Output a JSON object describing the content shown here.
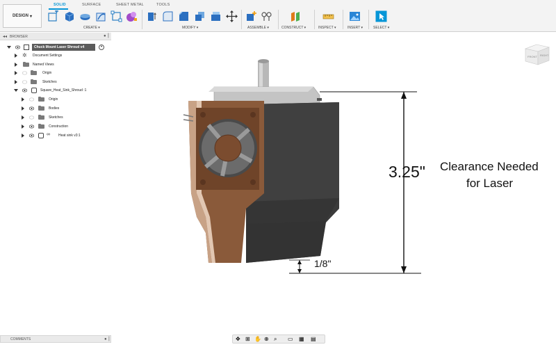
{
  "toolbar": {
    "workspace_label": "DESIGN",
    "tabs": [
      {
        "label": "SOLID"
      },
      {
        "label": "SURFACE"
      },
      {
        "label": "SHEET METAL"
      },
      {
        "label": "TOOLS"
      }
    ],
    "groups": [
      "CREATE",
      "MODIFY",
      "ASSEMBLE",
      "CONSTRUCT",
      "INSPECT",
      "INSERT",
      "SELECT"
    ],
    "accent": "#0696d7"
  },
  "browser": {
    "title": "BROWSER",
    "items": [
      {
        "label": "Chuck Mount Laser Shroud v4"
      },
      {
        "label": "Document Settings"
      },
      {
        "label": "Named Views"
      },
      {
        "label": "Origin"
      },
      {
        "label": "Sketches"
      },
      {
        "label": "Square_Heat_Sink_Shroud :1"
      },
      {
        "label": "Origin"
      },
      {
        "label": "Bodies"
      },
      {
        "label": "Sketches"
      },
      {
        "label": "Construction"
      },
      {
        "label": "Heat sink v3:1"
      }
    ]
  },
  "comments": {
    "title": "COMMENTS"
  },
  "viewcube": {
    "front": "FRONT",
    "right": "RIGHT"
  },
  "annotations": {
    "height_dimension": "3.25\"",
    "clearance_line1": "Clearance Needed",
    "clearance_line2": "for Laser",
    "gap_dimension": "1/8\""
  },
  "colors": {
    "panel_bg": "#f3f3f3",
    "part_dark": "#3a3a3a",
    "part_brown": "#8a5a3a"
  }
}
